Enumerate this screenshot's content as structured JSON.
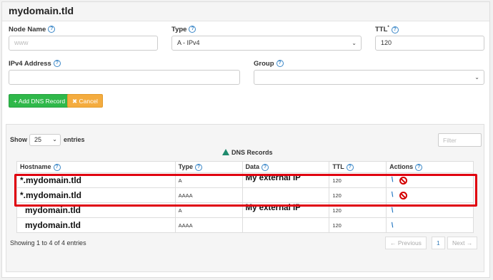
{
  "panel": {
    "title": "mydomain.tld"
  },
  "form": {
    "node_name": {
      "label": "Node Name",
      "placeholder": "www"
    },
    "type": {
      "label": "Type",
      "value": "A - IPv4"
    },
    "ttl": {
      "label": "TTL",
      "required_mark": "*",
      "value": "120"
    },
    "ipv4": {
      "label": "IPv4 Address",
      "value": ""
    },
    "group": {
      "label": "Group",
      "value": ""
    },
    "help_icon_glyph": "?",
    "add_button": "+ Add DNS Record",
    "cancel_button": "✖ Cancel"
  },
  "records": {
    "show_label": "Show",
    "page_size": "25",
    "entries_label": "entries",
    "filter_placeholder": "Filter",
    "grid_title": "DNS Records",
    "columns": [
      "Hostname",
      "Type",
      "Data",
      "TTL",
      "Actions"
    ],
    "rows": [
      {
        "hostname": "*.mydomain.tld",
        "type": "A",
        "data": "My external IP",
        "ttl": "120",
        "highlighted": true,
        "actions": [
          "edit-icon",
          "delete-icon"
        ]
      },
      {
        "hostname": "*.mydomain.tld",
        "type": "AAAA",
        "data": "",
        "ttl": "120",
        "highlighted": true,
        "actions": [
          "edit-icon",
          "delete-icon"
        ]
      },
      {
        "hostname": "mydomain.tld",
        "type": "A",
        "data": "My external IP",
        "ttl": "120",
        "highlighted": false,
        "actions": [
          "edit-icon"
        ]
      },
      {
        "hostname": "mydomain.tld",
        "type": "AAAA",
        "data": "",
        "ttl": "120",
        "highlighted": false,
        "actions": [
          "edit-icon"
        ]
      }
    ],
    "info": "Showing 1 to 4 of 4 entries",
    "pagination": {
      "previous": "← Previous",
      "page": "1",
      "next": "Next →"
    }
  },
  "colors": {
    "highlight_border": "#e0000f",
    "add_button": "#2fb84a",
    "cancel_button": "#f4ac3f",
    "link": "#337ab7"
  }
}
